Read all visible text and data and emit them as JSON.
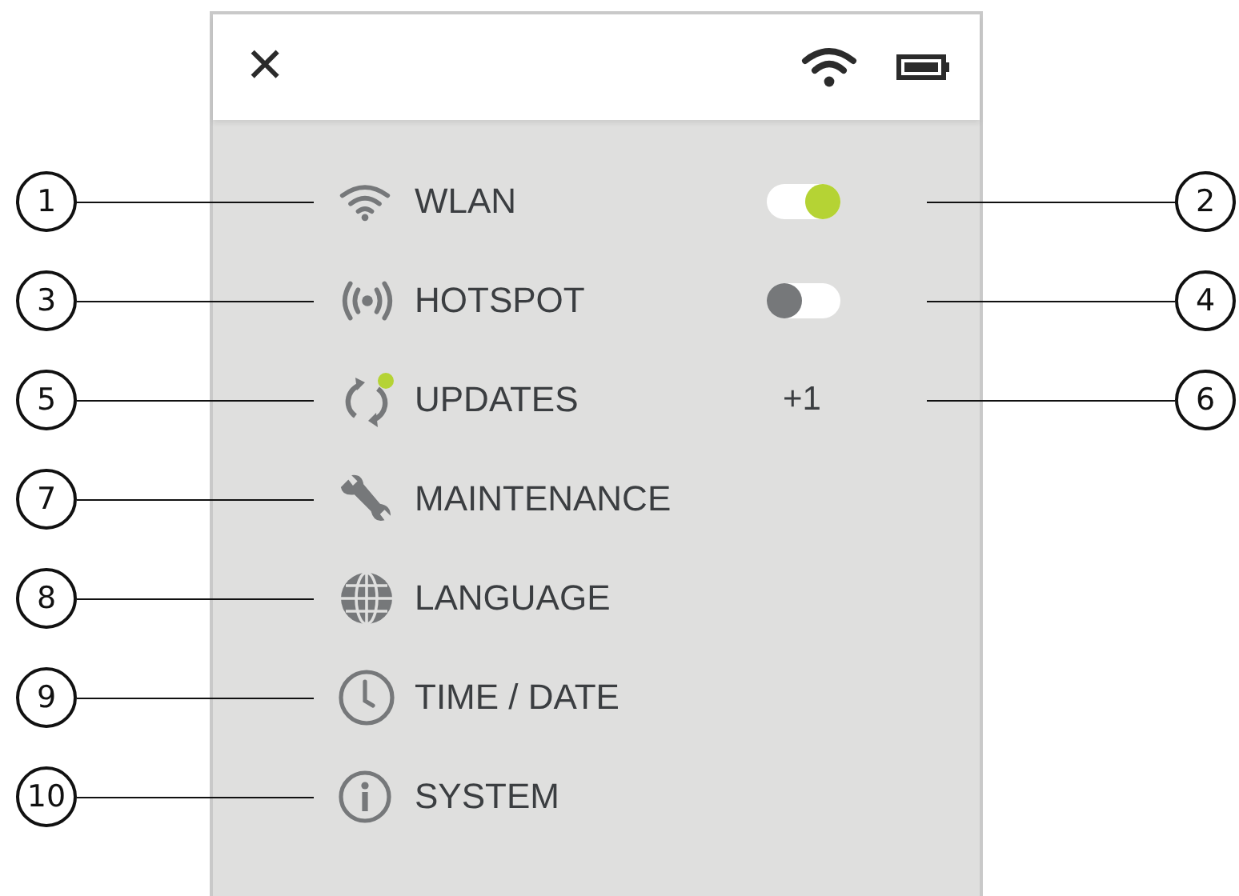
{
  "header": {
    "close": "✕"
  },
  "items": [
    {
      "label": "WLAN",
      "kind": "toggle",
      "on": true,
      "callout": "1",
      "value_callout": "2"
    },
    {
      "label": "HOTSPOT",
      "kind": "toggle",
      "on": false,
      "callout": "3",
      "value_callout": "4"
    },
    {
      "label": "UPDATES",
      "kind": "count",
      "count": "+1",
      "notification": true,
      "callout": "5",
      "value_callout": "6"
    },
    {
      "label": "MAINTENANCE",
      "kind": "plain",
      "callout": "7"
    },
    {
      "label": "LANGUAGE",
      "kind": "plain",
      "callout": "8"
    },
    {
      "label": "TIME / DATE",
      "kind": "plain",
      "callout": "9"
    },
    {
      "label": "SYSTEM",
      "kind": "plain",
      "callout": "10"
    }
  ]
}
